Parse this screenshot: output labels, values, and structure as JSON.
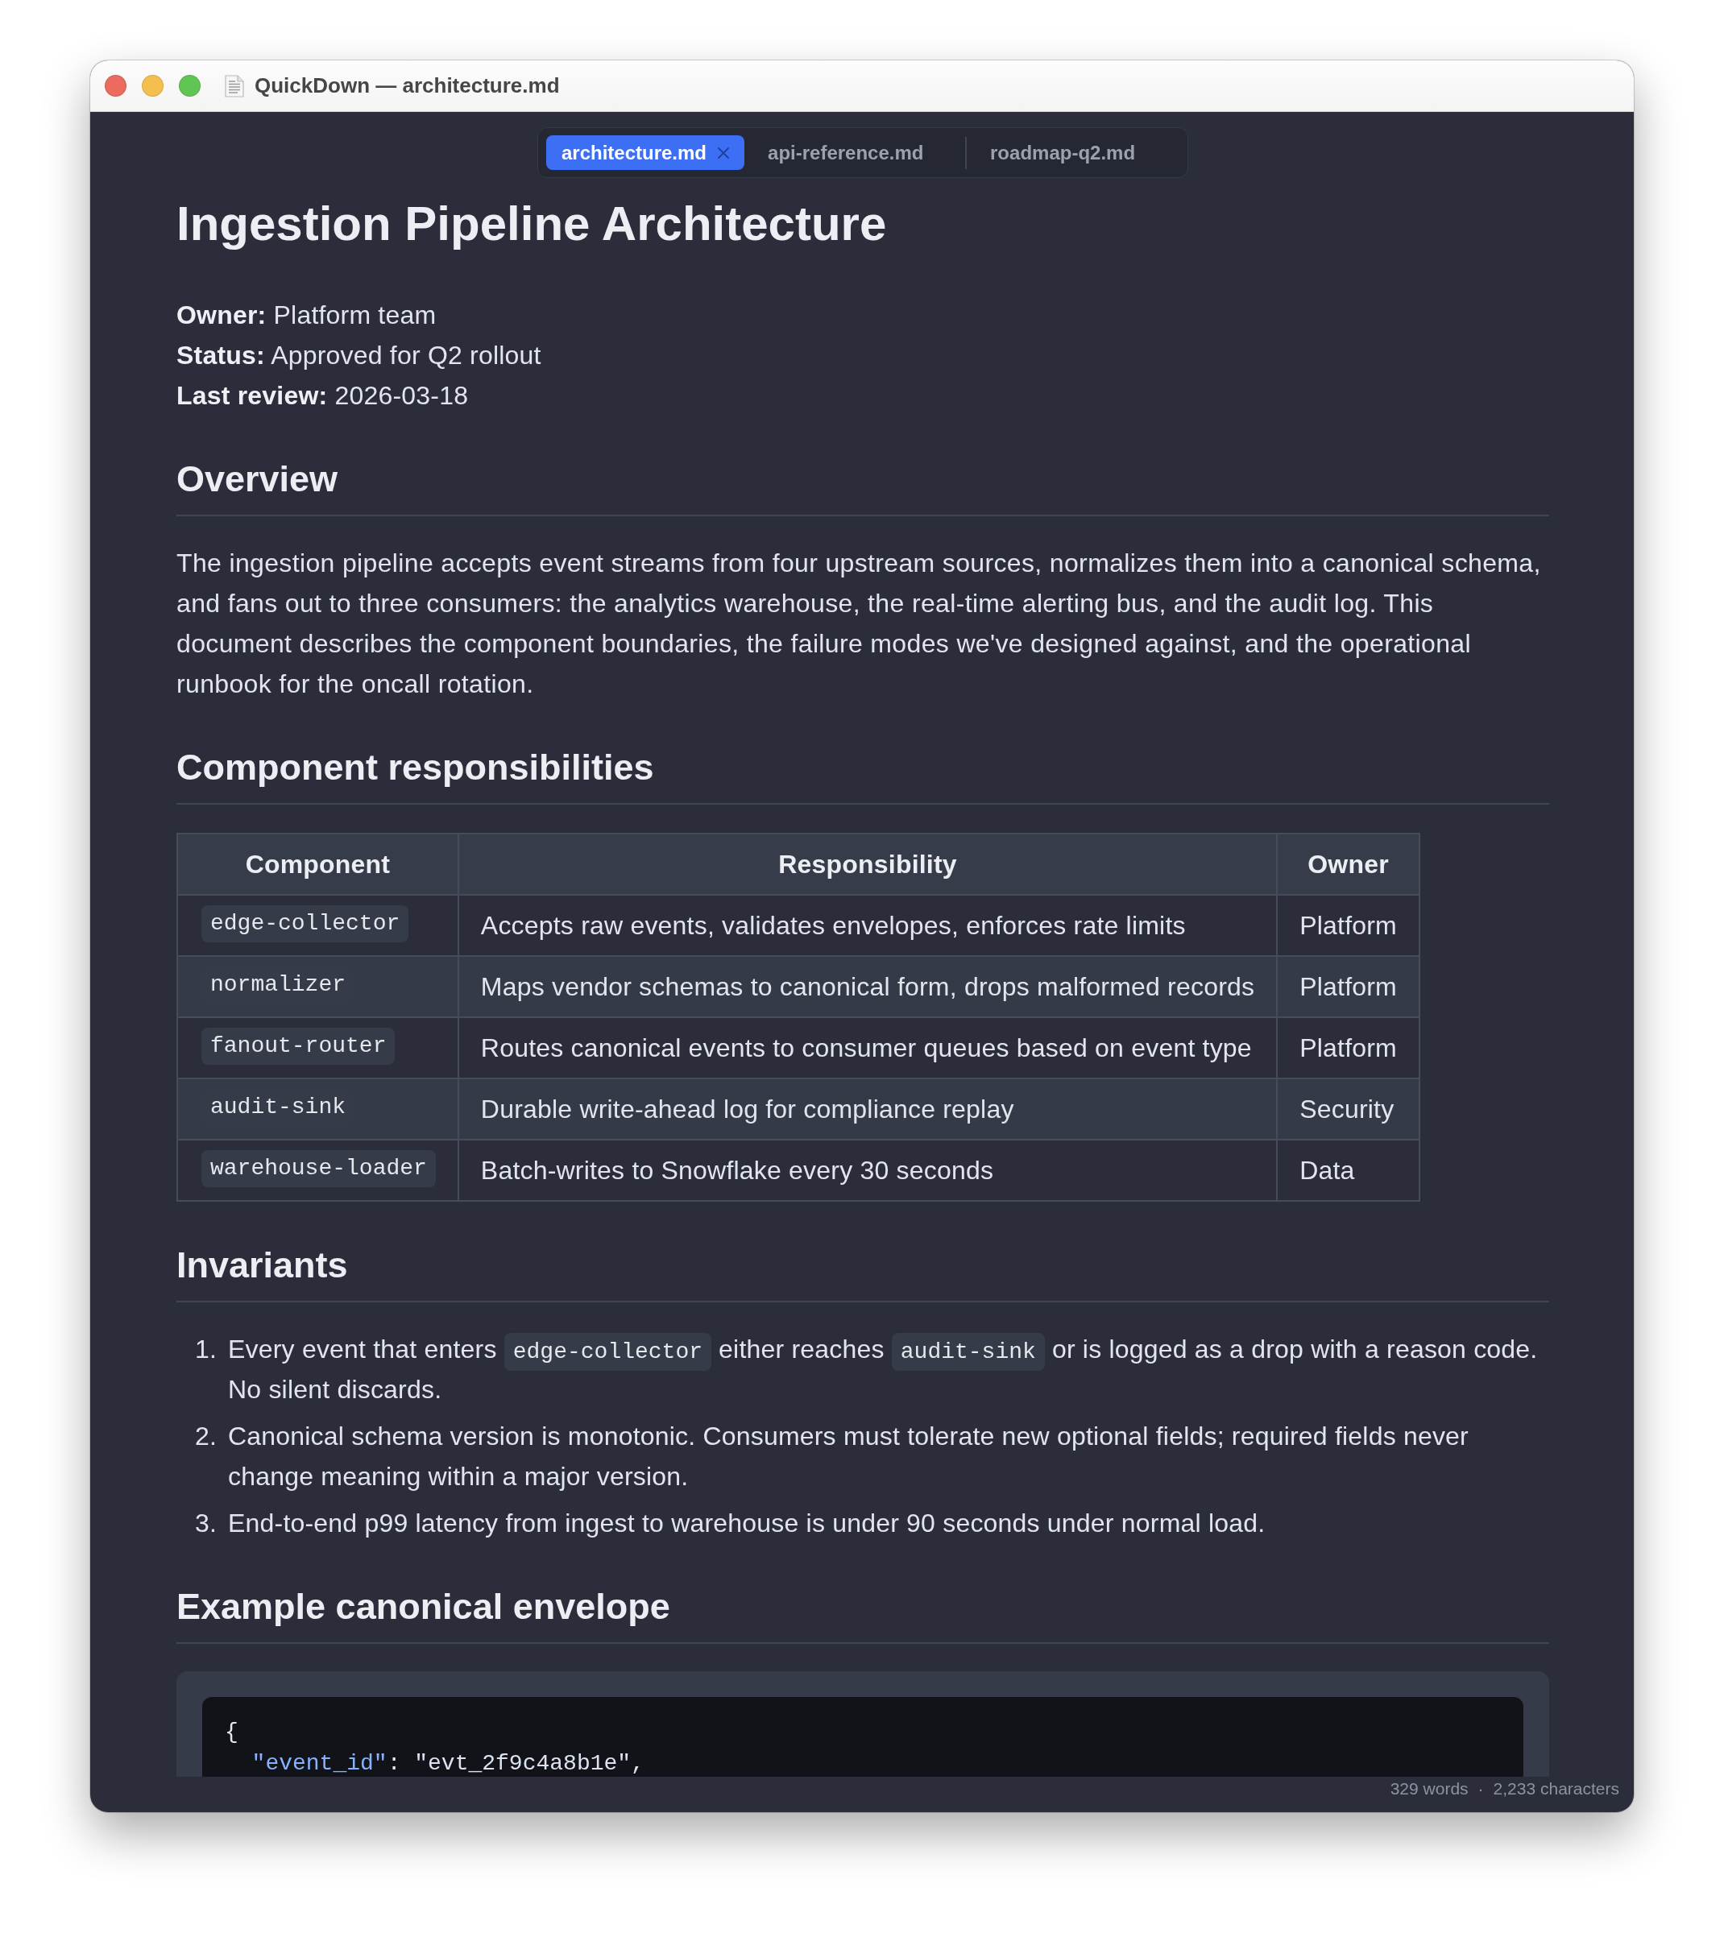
{
  "window": {
    "title": "QuickDown — architecture.md"
  },
  "tabs": [
    {
      "label": "architecture.md",
      "selected": true
    },
    {
      "label": "api-reference.md",
      "selected": false
    },
    {
      "label": "roadmap-q2.md",
      "selected": false
    }
  ],
  "document": {
    "title": "Ingestion Pipeline Architecture",
    "meta": [
      "**Owner:** Platform team",
      "**Status:** Approved for Q2 rollout",
      "**Last review:** 2026-03-18"
    ],
    "sections": [
      {
        "heading": "Overview",
        "blocks": [
          {
            "kind": "paragraph",
            "text": "The ingestion pipeline accepts event streams from four upstream sources, normalizes them into a canonical schema, and fans out to three consumers: the analytics warehouse, the real-time alerting bus, and the audit log. This document describes the component boundaries, the failure modes we've designed against, and the operational runbook for the oncall rotation."
          }
        ]
      },
      {
        "heading": "Component responsibilities",
        "blocks": [
          {
            "kind": "table",
            "columns": [
              "Component",
              "Responsibility",
              "Owner"
            ],
            "rows": [
              [
                {
                  "kind": "code",
                  "text": "edge-collector"
                },
                {
                  "kind": "text",
                  "text": "Accepts raw events, validates envelopes, enforces rate limits"
                },
                {
                  "kind": "text",
                  "text": "Platform"
                }
              ],
              [
                {
                  "kind": "code",
                  "text": "normalizer"
                },
                {
                  "kind": "text",
                  "text": "Maps vendor schemas to canonical form, drops malformed records"
                },
                {
                  "kind": "text",
                  "text": "Platform"
                }
              ],
              [
                {
                  "kind": "code",
                  "text": "fanout-router"
                },
                {
                  "kind": "text",
                  "text": "Routes canonical events to consumer queues based on event type"
                },
                {
                  "kind": "text",
                  "text": "Platform"
                }
              ],
              [
                {
                  "kind": "code",
                  "text": "audit-sink"
                },
                {
                  "kind": "text",
                  "text": "Durable write-ahead log for compliance replay"
                },
                {
                  "kind": "text",
                  "text": "Security"
                }
              ],
              [
                {
                  "kind": "code",
                  "text": "warehouse-loader"
                },
                {
                  "kind": "text",
                  "text": "Batch-writes to Snowflake every 30 seconds"
                },
                {
                  "kind": "text",
                  "text": "Data"
                }
              ]
            ]
          }
        ]
      },
      {
        "heading": "Invariants",
        "blocks": [
          {
            "kind": "ordered_list",
            "items": [
              {
                "number": "1.",
                "segments": [
                  {
                    "kind": "text",
                    "text": "Every event that enters "
                  },
                  {
                    "kind": "code",
                    "text": "edge-collector"
                  },
                  {
                    "kind": "text",
                    "text": " either reaches "
                  },
                  {
                    "kind": "code",
                    "text": "audit-sink"
                  },
                  {
                    "kind": "text",
                    "text": " or is logged as a drop with a reason code. No silent discards."
                  }
                ]
              },
              {
                "number": "2.",
                "segments": [
                  {
                    "kind": "text",
                    "text": "Canonical schema version is monotonic. Consumers must tolerate new optional fields; required fields never change meaning within a major version."
                  }
                ]
              },
              {
                "number": "3.",
                "segments": [
                  {
                    "kind": "text",
                    "text": "End-to-end p99 latency from ingest to warehouse is under 90 seconds under normal load."
                  }
                ]
              }
            ]
          }
        ]
      },
      {
        "heading": "Example canonical envelope",
        "blocks": [
          {
            "kind": "code_block",
            "lines": [
              [
                {
                  "kind": "punct",
                  "text": "{"
                }
              ],
              [
                {
                  "kind": "key",
                  "text": "  \"event_id\""
                },
                {
                  "kind": "punct",
                  "text": ": "
                },
                {
                  "kind": "string",
                  "text": "\"evt_2f9c4a8b1e\""
                },
                {
                  "kind": "punct",
                  "text": ","
                }
              ]
            ]
          }
        ]
      }
    ]
  },
  "status_bar": {
    "word_count": "329 words",
    "separator": "·",
    "char_count": "2,233 characters"
  }
}
